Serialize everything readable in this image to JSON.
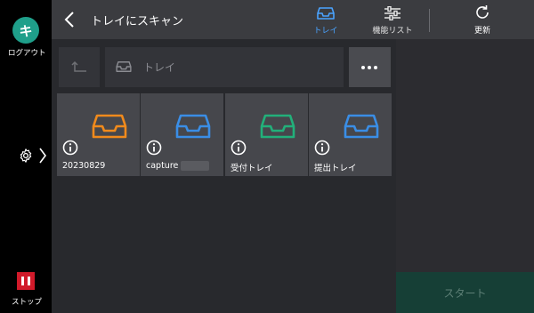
{
  "sidebar": {
    "logout_glyph": "キ",
    "logout_label": "ログアウト",
    "settings_icon": "gear-icon",
    "stop_label": "ストップ",
    "colors": {
      "logout": "#1f9f8a",
      "stop": "#d11a2a"
    }
  },
  "header": {
    "title": "トレイにスキャン",
    "tabs": [
      {
        "label": "トレイ",
        "icon": "tray-icon",
        "active": true
      },
      {
        "label": "機能リスト",
        "icon": "sliders-icon",
        "active": false
      },
      {
        "label": "更新",
        "icon": "refresh-icon",
        "active": false
      }
    ],
    "accent_color": "#4aa3ff"
  },
  "toolbar": {
    "up_icon": "up-level-icon",
    "path_label": "トレイ",
    "more_icon": "more-icon"
  },
  "trays": [
    {
      "name": "20230829",
      "color": "#f08a1c"
    },
    {
      "name": "capture",
      "color": "#3a8ee6"
    },
    {
      "name": "受付トレイ",
      "color": "#22b07a"
    },
    {
      "name": "提出トレイ",
      "color": "#3a8ee6"
    }
  ],
  "start_label": "スタート"
}
